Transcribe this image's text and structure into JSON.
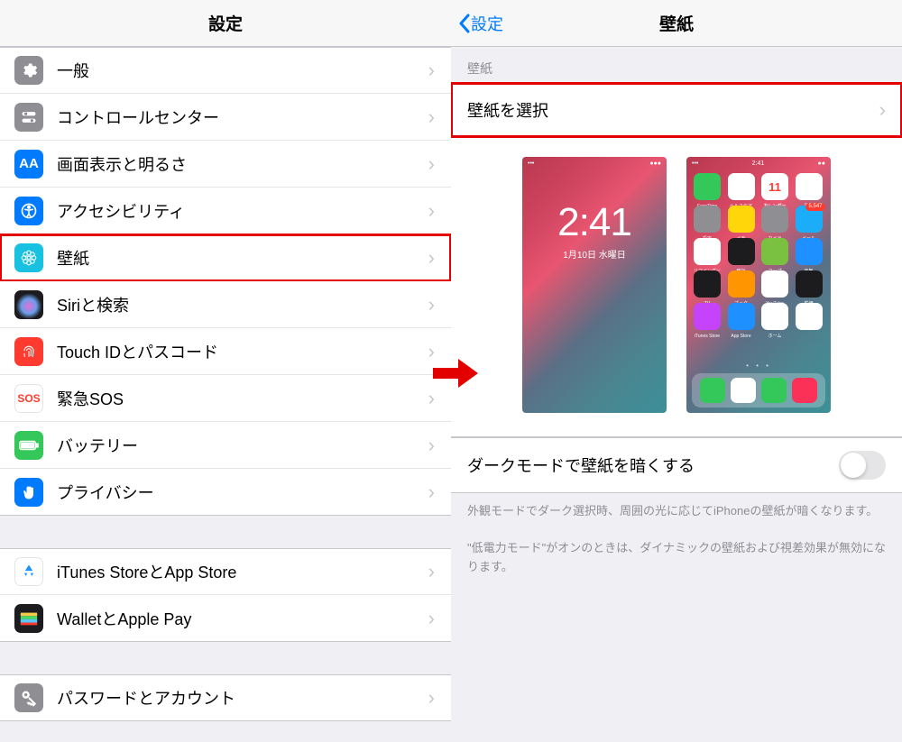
{
  "left": {
    "title": "設定",
    "rows": [
      {
        "id": "general",
        "label": "一般"
      },
      {
        "id": "control-center",
        "label": "コントロールセンター"
      },
      {
        "id": "display",
        "label": "画面表示と明るさ"
      },
      {
        "id": "accessibility",
        "label": "アクセシビリティ"
      },
      {
        "id": "wallpaper",
        "label": "壁紙",
        "highlighted": true
      },
      {
        "id": "siri",
        "label": "Siriと検索"
      },
      {
        "id": "touchid",
        "label": "Touch IDとパスコード"
      },
      {
        "id": "sos",
        "label": "緊急SOS"
      },
      {
        "id": "battery",
        "label": "バッテリー"
      },
      {
        "id": "privacy",
        "label": "プライバシー"
      }
    ],
    "group2": [
      {
        "id": "itunes",
        "label": "iTunes StoreとApp Store"
      },
      {
        "id": "wallet",
        "label": "WalletとApple Pay"
      }
    ],
    "group3": [
      {
        "id": "passwords",
        "label": "パスワードとアカウント"
      }
    ]
  },
  "right": {
    "back": "設定",
    "title": "壁紙",
    "section": "壁紙",
    "select": "壁紙を選択",
    "lock": {
      "time": "2:41",
      "date": "1月10日 水曜日"
    },
    "home_apps": [
      {
        "name": "FaceTime",
        "c": "#34c759"
      },
      {
        "name": "ヘルスケア",
        "c": "#fff"
      },
      {
        "name": "カレンダー",
        "c": "#fff",
        "txt": "11"
      },
      {
        "name": "写真",
        "c": "#fff"
      },
      {
        "name": "設定",
        "c": "#8e8e93"
      },
      {
        "name": "メモ",
        "c": "#ffd60a"
      },
      {
        "name": "カメラ",
        "c": "#8e8e93"
      },
      {
        "name": "メール",
        "c": "#1badf8",
        "badge": "5,547"
      },
      {
        "name": "リマインダー",
        "c": "#fff"
      },
      {
        "name": "時計",
        "c": "#1c1c1e"
      },
      {
        "name": "マップ",
        "c": "#7ac142"
      },
      {
        "name": "天気",
        "c": "#1e90ff"
      },
      {
        "name": "TV",
        "c": "#1c1c1e"
      },
      {
        "name": "ブック",
        "c": "#ff9500"
      },
      {
        "name": "YouTube",
        "c": "#fff"
      },
      {
        "name": "株価",
        "c": "#1c1c1e"
      },
      {
        "name": "iTunes Store",
        "c": "#c643fc"
      },
      {
        "name": "App Store",
        "c": "#1e90ff"
      },
      {
        "name": "ホーム",
        "c": "#fff"
      },
      {
        "name": "",
        "c": "#fff"
      }
    ],
    "dock": [
      {
        "c": "#34c759"
      },
      {
        "c": "#fff"
      },
      {
        "c": "#34c759"
      },
      {
        "c": "#fc3158"
      }
    ],
    "dark_mode": {
      "label": "ダークモードで壁紙を暗くする",
      "on": false
    },
    "desc1": "外観モードでダーク選択時、周囲の光に応じてiPhoneの壁紙が暗くなります。",
    "desc2": "\"低電力モード\"がオンのときは、ダイナミックの壁紙および視差効果が無効になります。"
  }
}
